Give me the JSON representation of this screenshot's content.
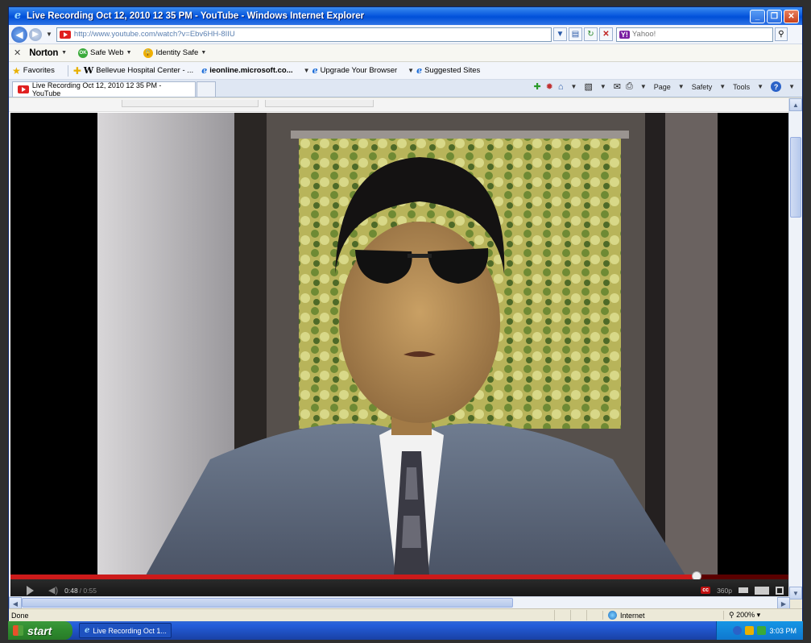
{
  "window": {
    "title": "Live Recording Oct 12, 2010 12 35 PM - YouTube - Windows Internet Explorer",
    "minimize": "_",
    "maximize": "❐",
    "close": "✕"
  },
  "address": {
    "url": "http://www.youtube.com/watch?v=Ebv6HH-8IIU",
    "search_placeholder": "Yahoo!",
    "search_brand": "Y!"
  },
  "norton": {
    "close": "✕",
    "brand": "Norton",
    "safe_web": "Safe Web",
    "ok_badge": "OK",
    "identity_safe": "Identity Safe"
  },
  "favorites": {
    "label": "Favorites",
    "items": [
      "Bellevue Hospital Center - ...",
      "ieonline.microsoft.co...",
      "Upgrade Your Browser",
      "Suggested Sites"
    ]
  },
  "tab": {
    "label": "Live Recording Oct 12, 2010 12 35 PM - YouTube"
  },
  "commandbar": {
    "page": "Page",
    "safety": "Safety",
    "tools": "Tools",
    "help": "?"
  },
  "player": {
    "time_current": "0:48",
    "time_duration": "/ 0:55",
    "progress": 0.88,
    "cc": "cc",
    "quality": "360p"
  },
  "status": {
    "text": "Done",
    "zone": "Internet",
    "zoom": "200%"
  },
  "taskbar": {
    "start": "start",
    "task_item": "Live Recording Oct 1...",
    "clock": "3:03 PM"
  },
  "colors": {
    "title_blue": "#0a5adf",
    "progress_red": "#cc1a1a",
    "start_green": "#2e8a2e",
    "tray_blue": "#0f78cf"
  }
}
